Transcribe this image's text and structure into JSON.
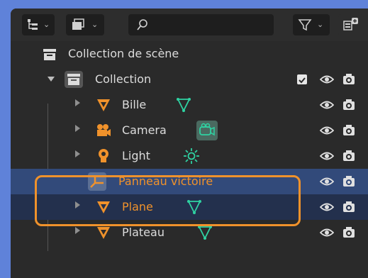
{
  "outliner": {
    "scene_collection_label": "Collection de scène",
    "collection_label": "Collection",
    "items": [
      {
        "label": "Bille"
      },
      {
        "label": "Camera"
      },
      {
        "label": "Light"
      },
      {
        "label": "Panneau victoire"
      },
      {
        "label": "Plane"
      },
      {
        "label": "Plateau"
      }
    ]
  },
  "colors": {
    "accent_orange": "#f0922b",
    "selection_row": "#324a7a",
    "highlight_row": "#23304d",
    "mesh_green": "#2fd2a2"
  },
  "icons": {
    "toolbar_left": "outliner-display-mode-icon",
    "toolbar_filter": "filter-icon",
    "search": "search-icon",
    "new_collection": "new-collection-icon"
  }
}
